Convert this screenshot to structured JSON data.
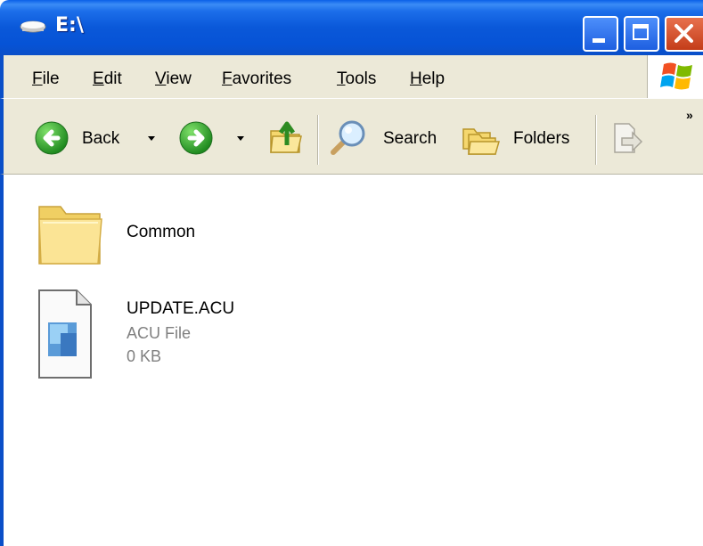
{
  "window": {
    "title": "E:\\"
  },
  "menu": {
    "items": [
      "File",
      "Edit",
      "View",
      "Favorites",
      "Tools",
      "Help"
    ]
  },
  "toolbar": {
    "back_label": "Back",
    "search_label": "Search",
    "folders_label": "Folders",
    "overflow_label": "»"
  },
  "files": [
    {
      "name": "Common",
      "icon": "folder-icon"
    },
    {
      "name": "UPDATE.ACU",
      "type": "ACU File",
      "size": "0 KB",
      "icon": "file-icon"
    }
  ]
}
